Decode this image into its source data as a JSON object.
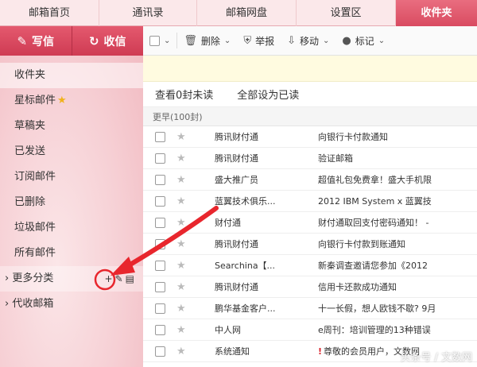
{
  "topnav": {
    "tabs": [
      {
        "label": "邮箱首页",
        "active": false
      },
      {
        "label": "通讯录",
        "active": false
      },
      {
        "label": "邮箱网盘",
        "active": false
      },
      {
        "label": "设置区",
        "active": false
      },
      {
        "label": "收件夹",
        "active": true
      }
    ]
  },
  "sidebar": {
    "write_label": "写信",
    "receive_label": "收信",
    "folders": [
      {
        "label": "收件夹",
        "active": true
      },
      {
        "label": "星标邮件",
        "star": true
      },
      {
        "label": "草稿夹"
      },
      {
        "label": "已发送"
      },
      {
        "label": "订阅邮件"
      },
      {
        "label": "已删除"
      },
      {
        "label": "垃圾邮件"
      },
      {
        "label": "所有邮件"
      },
      {
        "label": "更多分类",
        "caret": true
      },
      {
        "label": "代收邮箱",
        "caret": true
      }
    ]
  },
  "toolbar": {
    "delete_label": "删除",
    "report_label": "举报",
    "move_label": "移动",
    "tag_label": "标记"
  },
  "actions": {
    "view_unread": "查看0封未读",
    "mark_all_read": "全部设为已读"
  },
  "group_label": "更早(100封)",
  "emails": [
    {
      "sender": "腾讯财付通",
      "subject": "向银行卡付款通知"
    },
    {
      "sender": "腾讯财付通",
      "subject": "验证邮箱"
    },
    {
      "sender": "盛大推广员",
      "subject": "超值礼包免费拿！盛大手机限"
    },
    {
      "sender": "蓝翼技术俱乐...",
      "subject": "2012 IBM System x 蓝翼技"
    },
    {
      "sender": "财付通",
      "subject": "财付通取回支付密码通知！ -"
    },
    {
      "sender": "腾讯财付通",
      "subject": "向银行卡付款到账通知"
    },
    {
      "sender": "Searchina【...",
      "subject": "新秦调查邀请您参加《2012"
    },
    {
      "sender": "腾讯财付通",
      "subject": "信用卡还款成功通知"
    },
    {
      "sender": "鹏华基金客户...",
      "subject": "十一长假，想人欧钱不歇? 9月"
    },
    {
      "sender": "中人网",
      "subject": "e周刊：培训管理的13种错误"
    },
    {
      "sender": "系统通知",
      "subject": "尊敬的会员用户，文数网",
      "flag": "!"
    }
  ],
  "watermark": "头条号 / 文数网",
  "colors": {
    "accent": "#d94b61",
    "arrow": "#e8262d"
  }
}
